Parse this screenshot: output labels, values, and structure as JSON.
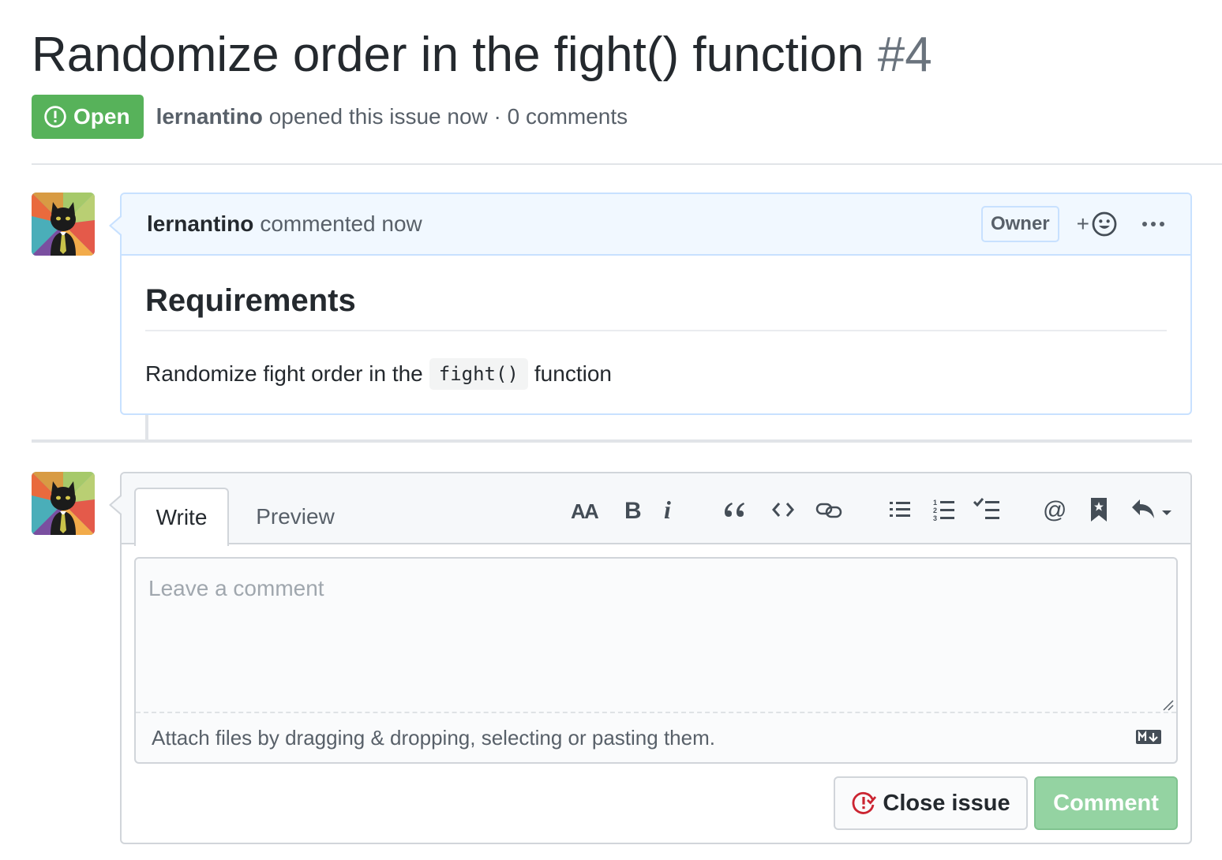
{
  "issue": {
    "title": "Randomize order in the fight() function",
    "number": "#4",
    "state": "Open",
    "author": "lernantino",
    "opened_text": "opened this issue now · 0 comments"
  },
  "comment": {
    "author": "lernantino",
    "action_text": "commented now",
    "role_label": "Owner",
    "reaction_plus": "+",
    "heading": "Requirements",
    "body_before": "Randomize fight order in the",
    "body_code": "fight()",
    "body_after": "function"
  },
  "editor": {
    "tabs": [
      {
        "label": "Write",
        "active": true
      },
      {
        "label": "Preview",
        "active": false
      }
    ],
    "toolbar": [
      "heading-icon",
      "bold-icon",
      "italic-icon",
      "quote-icon",
      "code-icon",
      "link-icon",
      "unordered-list-icon",
      "ordered-list-icon",
      "task-list-icon",
      "mention-icon",
      "saved-reply-icon",
      "reply-icon"
    ],
    "placeholder": "Leave a comment",
    "attach_text": "Attach files by dragging & dropping, selecting or pasting them.",
    "close_button": "Close issue",
    "comment_button": "Comment"
  },
  "colors": {
    "open_badge": "#57b25a",
    "comment_header_bg": "#f1f8ff",
    "comment_border": "#c8e1ff",
    "comment_button_disabled": "#94d3a2",
    "close_icon": "#cb2431"
  }
}
